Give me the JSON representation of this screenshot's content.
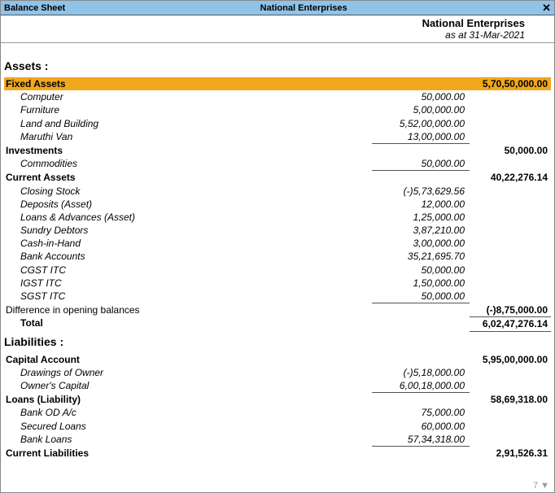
{
  "title": {
    "left": "Balance Sheet",
    "center": "National Enterprises"
  },
  "header": {
    "company": "National Enterprises",
    "asat": "as at 31-Mar-2021"
  },
  "assets_label": "Assets :",
  "liabilities_label": "Liabilities :",
  "total_label": "Total",
  "diff_label": "Difference in opening balances",
  "diff_value": "(-)8,75,000.00",
  "total_value": "6,02,47,276.14",
  "groups_assets": [
    {
      "name": "Fixed Assets",
      "total": "5,70,50,000.00",
      "highlight": true,
      "items": [
        {
          "name": "Computer",
          "value": "50,000.00"
        },
        {
          "name": "Furniture",
          "value": "5,00,000.00"
        },
        {
          "name": "Land and Building",
          "value": "5,52,00,000.00"
        },
        {
          "name": "Maruthi Van",
          "value": "13,00,000.00"
        }
      ]
    },
    {
      "name": "Investments",
      "total": "50,000.00",
      "items": [
        {
          "name": "Commodities",
          "value": "50,000.00"
        }
      ]
    },
    {
      "name": "Current Assets",
      "total": "40,22,276.14",
      "items": [
        {
          "name": "Closing Stock",
          "value": "(-)5,73,629.56"
        },
        {
          "name": "Deposits (Asset)",
          "value": "12,000.00"
        },
        {
          "name": "Loans & Advances (Asset)",
          "value": "1,25,000.00"
        },
        {
          "name": "Sundry Debtors",
          "value": "3,87,210.00"
        },
        {
          "name": "Cash-in-Hand",
          "value": "3,00,000.00"
        },
        {
          "name": "Bank Accounts",
          "value": "35,21,695.70"
        },
        {
          "name": "CGST ITC",
          "value": "50,000.00"
        },
        {
          "name": "IGST ITC",
          "value": "1,50,000.00"
        },
        {
          "name": "SGST ITC",
          "value": "50,000.00"
        }
      ]
    }
  ],
  "groups_liab": [
    {
      "name": "Capital Account",
      "total": "5,95,00,000.00",
      "items": [
        {
          "name": "Drawings of Owner",
          "value": "(-)5,18,000.00"
        },
        {
          "name": "Owner's Capital",
          "value": "6,00,18,000.00"
        }
      ]
    },
    {
      "name": "Loans (Liability)",
      "total": "58,69,318.00",
      "items": [
        {
          "name": "Bank OD A/c",
          "value": "75,000.00"
        },
        {
          "name": "Secured Loans",
          "value": "60,000.00"
        },
        {
          "name": "Bank Loans",
          "value": "57,34,318.00"
        }
      ]
    },
    {
      "name": "Current Liabilities",
      "total": "2,91,526.31",
      "items": []
    }
  ],
  "footer_more": "7 ▼"
}
